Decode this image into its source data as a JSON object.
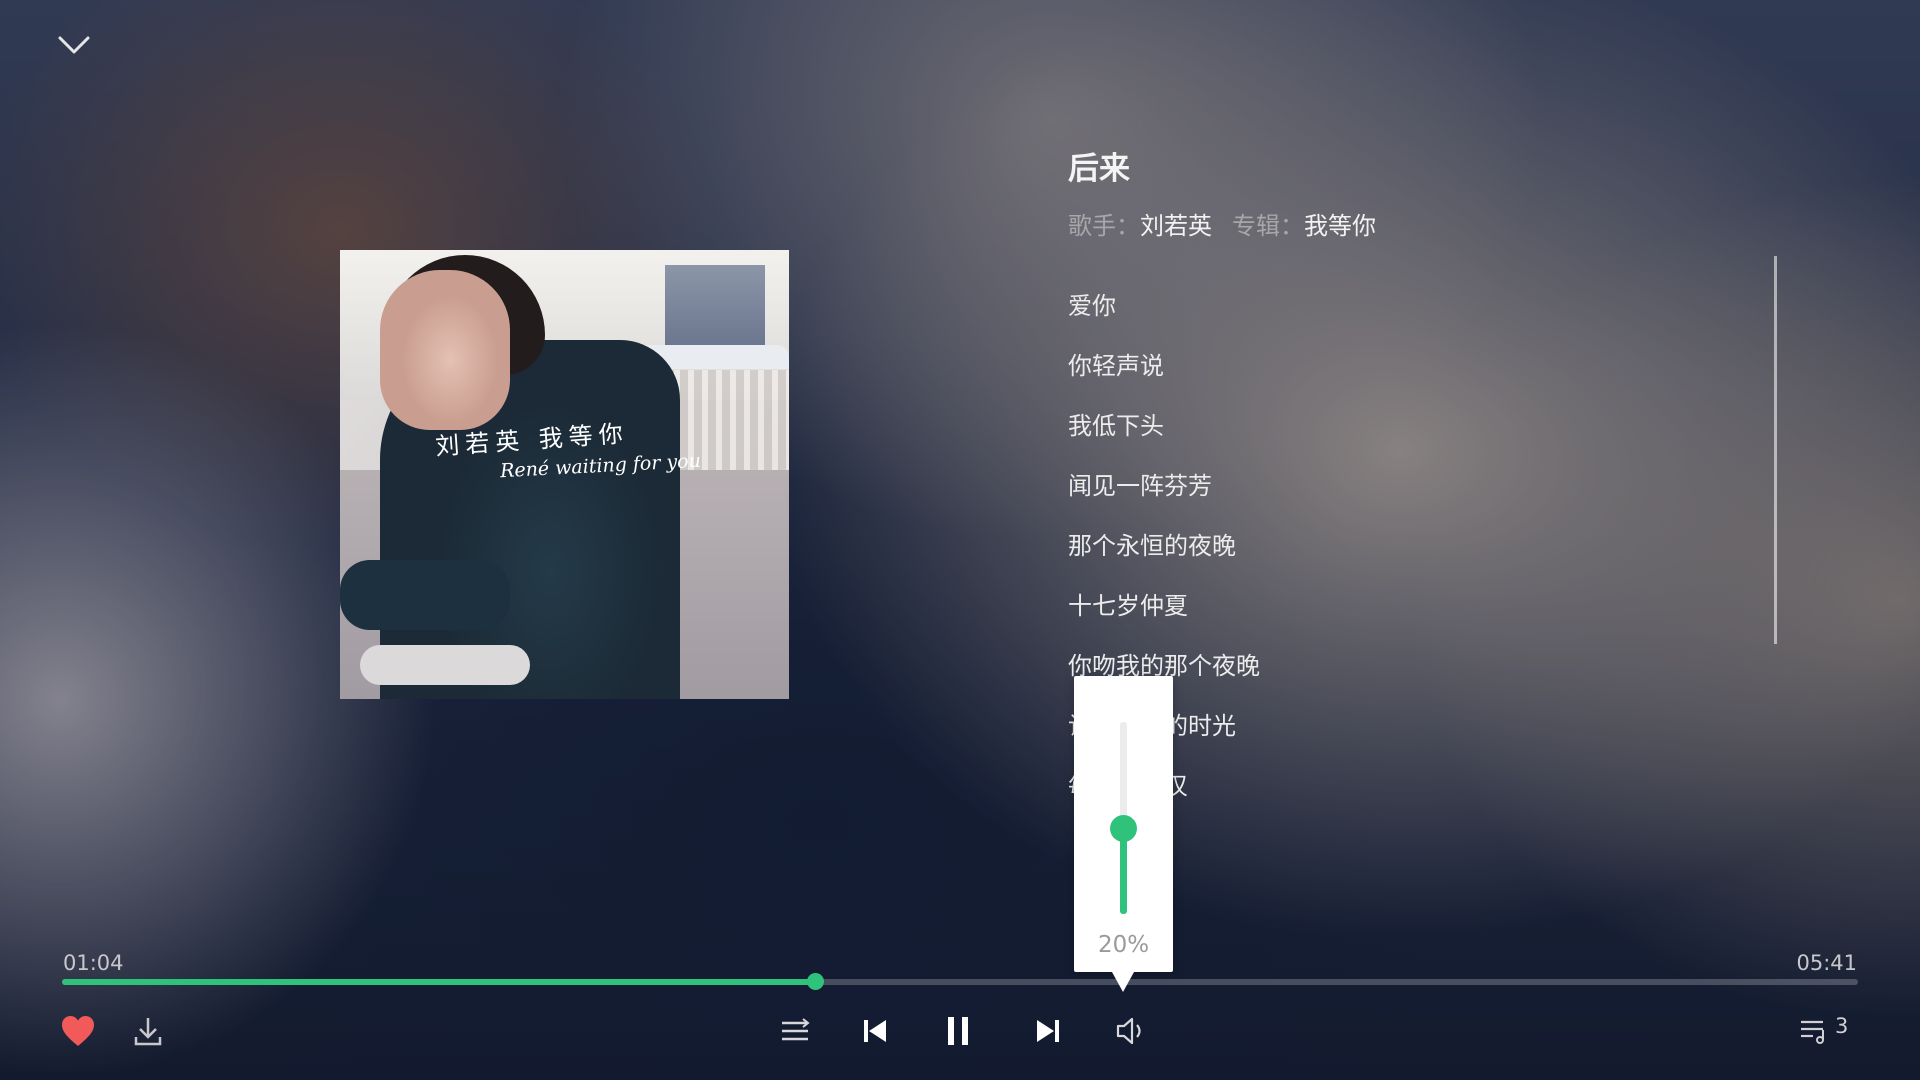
{
  "song": {
    "title": "后来",
    "artist_label": "歌手：",
    "artist": "刘若英",
    "album_label": "专辑：",
    "album": "我等你"
  },
  "cover": {
    "handwriting_line1": "刘若英 我等你",
    "handwriting_line2": "René waiting for you"
  },
  "lyrics": [
    "爱你",
    "你轻声说",
    "我低下头",
    "闻见一阵芬芳",
    "那个永恒的夜晚",
    "十七岁仲夏",
    "你吻我的那个夜晚",
    "让我往后的时光",
    "每当有感叹"
  ],
  "player": {
    "current_time": "01:04",
    "total_time": "05:41",
    "progress_fraction": 0.419,
    "volume_percent_text": "20%",
    "volume_fraction": 0.45,
    "playlist_count": "3",
    "accent_color": "#2fc27a",
    "like_color": "#f25a5a"
  },
  "icons": {
    "collapse": "chevron-down-icon",
    "like": "heart-icon",
    "download": "download-icon",
    "mode": "play-mode-icon",
    "prev": "skip-previous-icon",
    "pause": "pause-icon",
    "next": "skip-next-icon",
    "volume": "volume-icon",
    "playlist": "playlist-icon"
  }
}
